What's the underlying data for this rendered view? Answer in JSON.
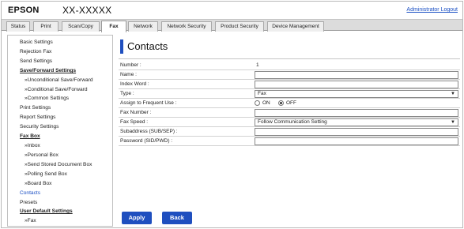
{
  "header": {
    "brand": "EPSON",
    "model": "XX-XXXXX",
    "admin_logout": "Administrator Logout"
  },
  "tabs": [
    {
      "label": "Status",
      "active": false
    },
    {
      "label": "Print",
      "active": false
    },
    {
      "label": "Scan/Copy",
      "active": false
    },
    {
      "label": "Fax",
      "active": true
    },
    {
      "label": "Network",
      "active": false
    },
    {
      "label": "Network Security",
      "active": false
    },
    {
      "label": "Product Security",
      "active": false
    },
    {
      "label": "Device Management",
      "active": false
    }
  ],
  "sidebar": {
    "basic_settings": "Basic Settings",
    "rejection_fax": "Rejection Fax",
    "send_settings": "Send Settings",
    "save_forward_settings": "Save/Forward Settings",
    "unconditional_save_forward": "»Unconditional Save/Forward",
    "conditional_save_forward": "»Conditional Save/Forward",
    "common_settings": "»Common Settings",
    "print_settings": "Print Settings",
    "report_settings": "Report Settings",
    "security_settings": "Security Settings",
    "fax_box": "Fax Box",
    "inbox": "»Inbox",
    "personal_box": "»Personal Box",
    "send_stored_document_box": "»Send Stored Document Box",
    "polling_send_box": "»Polling Send Box",
    "board_box": "»Board Box",
    "contacts": "Contacts",
    "presets": "Presets",
    "user_default_settings": "User Default Settings",
    "fax": "»Fax"
  },
  "main": {
    "title": "Contacts",
    "number_label": "Number :",
    "number_value": "1",
    "name_label": "Name :",
    "name_value": "",
    "index_word_label": "Index Word :",
    "index_word_value": "",
    "type_label": "Type :",
    "type_value": "Fax",
    "assign_label": "Assign to Frequent Use :",
    "assign_on": "ON",
    "assign_off": "OFF",
    "assign_selected": "OFF",
    "fax_number_label": "Fax Number :",
    "fax_number_value": "",
    "fax_speed_label": "Fax Speed :",
    "fax_speed_value": "Follow Communication Setting",
    "subaddress_label": "Subaddress (SUB/SEP) :",
    "subaddress_value": "",
    "password_label": "Password (SID/PWD) :",
    "password_value": ""
  },
  "buttons": {
    "apply": "Apply",
    "back": "Back"
  },
  "colors": {
    "accent": "#1f4fbf",
    "link": "#1a4fc4"
  }
}
